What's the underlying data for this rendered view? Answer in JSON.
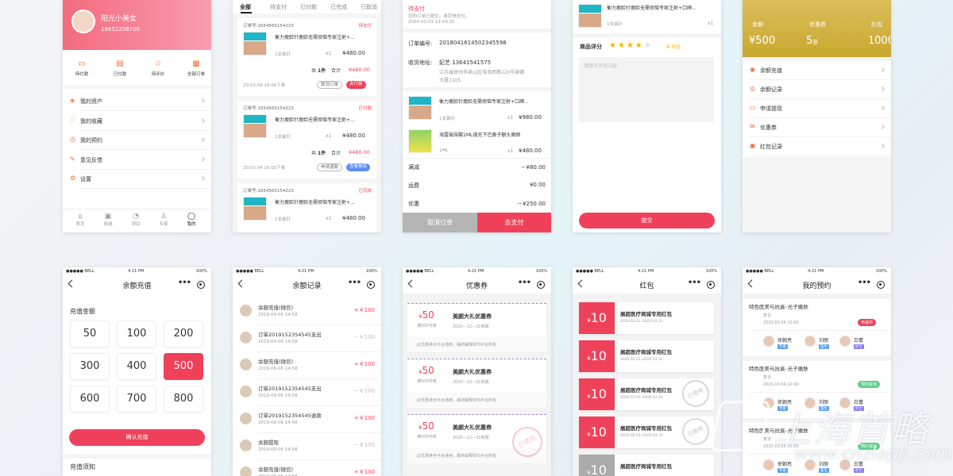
{
  "profile": {
    "name": "阳光小美女",
    "phone": "18652258700",
    "orders": [
      "待付款",
      "已付款",
      "待评价",
      "全部订单"
    ],
    "menu": [
      "我的资产",
      "我的收藏",
      "我的预约",
      "意见反馈",
      "设置"
    ],
    "tabs": [
      "首页",
      "商城",
      "项目",
      "专家",
      "我的"
    ]
  },
  "orders": {
    "tabs": [
      "全部",
      "待支付",
      "已付款",
      "已完成",
      "已取消"
    ],
    "items": [
      {
        "no": "订单号:1654565154223",
        "status": "待支付",
        "title": "衡力瘦脸针瘦脸无需烦恼专家注射+...",
        "spec": "1支装针",
        "qty": "x1",
        "price": "¥480.00",
        "total_a": "共",
        "total_b": "1件",
        "total_c": "合计",
        "total_v": "¥480.00",
        "time": "20:03.04 16:09下单",
        "btn1": "取消订单",
        "btn2": "去付款"
      },
      {
        "no": "订单号:1654565154223",
        "status": "已付款",
        "title": "衡力瘦脸针瘦脸无需烦恼专家注射+...",
        "spec": "1支装针",
        "qty": "x1",
        "price": "¥480.00",
        "total_a": "共",
        "total_b": "1件",
        "total_c": "合计",
        "total_v": "¥480.00",
        "time": "20:03.04 16:09下单",
        "btn1": "申请退款",
        "btn2": "查看物流"
      },
      {
        "no": "订单号:1654565154223",
        "status": "已完成",
        "title": "衡力瘦脸针瘦脸无需烦恼专家注射+...",
        "spec": "1支装针",
        "qty": "x1",
        "price": "¥480.00"
      }
    ]
  },
  "detail": {
    "status": "待支付",
    "note": "您的订单已提交，请尽快支付。",
    "time": "2020-03-01 13:54:25",
    "order_no_label": "订单编号:",
    "order_no": "2018041614502345598",
    "addr_label": "收货地址:",
    "person": "妃艺 13641541575",
    "addr1": "江苏省徐州市泉山区淮海西路120号颖都",
    "addr2": "大厦1105",
    "items": [
      {
        "title": "衡力瘦脸针瘦脸无需烦恼专家注射+口碑...",
        "spec": "1支装针",
        "qty": "x1",
        "price": "¥980.00"
      },
      {
        "title": "海露玻尿酸1ML填充下巴鼻子额头面颊",
        "spec": "1ML",
        "qty": "x1",
        "price": "¥480.00"
      }
    ],
    "fees": [
      {
        "k": "满减",
        "v": "－¥80.00"
      },
      {
        "k": "运费",
        "v": "¥0.00"
      },
      {
        "k": "优惠",
        "v": "－¥250.00"
      }
    ],
    "cancel": "取消订单",
    "pay": "去支付"
  },
  "review": {
    "title": "衡力瘦脸针瘦脸无需烦恼专家注射+口碑...",
    "spec": "1支装针",
    "qty": "x1",
    "score_label": "商品评分",
    "score": "4.0分",
    "rating": 4,
    "placeholder": "请填写评论内容",
    "submit": "提交"
  },
  "wallet": {
    "stats": [
      {
        "k": "余额",
        "v": "¥500"
      },
      {
        "k": "优惠券",
        "v": "5",
        "u": "张"
      },
      {
        "k": "红包",
        "v": "1000"
      }
    ],
    "menu": [
      "余额充值",
      "余额记录",
      "申请提现",
      "优惠券",
      "红包记录"
    ]
  },
  "status_bar": {
    "carrier": "●●●●● BELL",
    "time": "4:21 PM",
    "battery": "100%"
  },
  "recharge": {
    "title": "余额充值",
    "section": "充值金额",
    "amounts": [
      "50",
      "100",
      "200",
      "300",
      "400",
      "500",
      "600",
      "700",
      "800"
    ],
    "selected": "500",
    "confirm": "确认充值",
    "notice": "充值须知"
  },
  "records": {
    "title": "余额记录",
    "items": [
      {
        "t": "余额充值(微信)",
        "d": "2019-09-06 14:58",
        "v": "+￥100",
        "in": true
      },
      {
        "t": "订单2019152354545支出",
        "d": "2019-09-06 14:58",
        "v": "－￥100",
        "in": false
      },
      {
        "t": "余额充值(微信)",
        "d": "2019-09-06 14:58",
        "v": "+￥100",
        "in": true
      },
      {
        "t": "订单2019152354545支出",
        "d": "2019-09-06 14:58",
        "v": "－￥100",
        "in": false
      },
      {
        "t": "订单2019152354545退款",
        "d": "2019-09-06 14:58",
        "v": "+￥100",
        "in": true
      },
      {
        "t": "余额提现",
        "d": "2019-09-06 14:58",
        "v": "－￥100",
        "in": false
      },
      {
        "t": "余额充值(微信)",
        "d": "2019-09-06 14:58",
        "v": "+￥100",
        "in": true
      }
    ]
  },
  "coupons": {
    "title": "优惠券",
    "items": [
      {
        "amt": "50",
        "min": "满500可用",
        "name": "美颜大礼优惠券",
        "exp": "2020—12—31到期",
        "rule": "此优惠券全平台通用，最终解释权归平台所有"
      },
      {
        "amt": "50",
        "min": "满500可用",
        "name": "美颜大礼优惠券",
        "exp": "2020—12—31到期",
        "rule": "此优惠券全平台通用，最终解释权归平台所有"
      },
      {
        "amt": "50",
        "min": "满500可用",
        "name": "美颜大礼优惠券",
        "exp": "2020—12—31到期",
        "rule": "此优惠券全平台通用，最终解释权归平台所有",
        "used": "已使用"
      }
    ]
  },
  "redpacks": {
    "title": "红包",
    "items": [
      {
        "amt": "10",
        "name": "展超医疗商城专用红包",
        "date": "2020.02.01–2020.03.31"
      },
      {
        "amt": "10",
        "name": "展超医疗商城专用红包",
        "date": "2020.02.01–2020.03.31"
      },
      {
        "amt": "10",
        "name": "展超医疗商城专用红包",
        "date": "2020.02.01–2020.03.31",
        "used": "已使用"
      },
      {
        "amt": "10",
        "name": "展超医疗商城专用红包",
        "date": "2020.02.01–2020.03.31",
        "used": "已使用"
      },
      {
        "amt": "10",
        "name": "展超医疗商城专用红包",
        "date": "",
        "gray": true
      }
    ]
  },
  "appoint": {
    "title": "我的预约",
    "items": [
      {
        "name": "特色医美与抗衰–光子嫩肤",
        "t1": "复诊",
        "t2": "2020.03.04 10:00",
        "status": "申请中",
        "docs": [
          {
            "n": "徐朝亮",
            "r": "专家"
          },
          {
            "n": "刘丽",
            "r": "医生"
          },
          {
            "n": "白蕾",
            "r": "护士"
          }
        ]
      },
      {
        "name": "特色医美与抗衰–光子嫩肤",
        "t1": "复诊",
        "t2": "2020.03.04 10:00",
        "status": "预约成功",
        "docs": [
          {
            "n": "徐朝亮",
            "r": "专家"
          },
          {
            "n": "刘丽",
            "r": "医生"
          },
          {
            "n": "白蕾",
            "r": "护士"
          }
        ]
      },
      {
        "name": "特色医美与抗衰–光子嫩肤",
        "t1": "复诊",
        "t2": "2020.03.04 10:00",
        "status": "预约成功",
        "docs": [
          {
            "n": "徐朝亮",
            "r": "专家"
          },
          {
            "n": "刘丽",
            "r": "医生"
          },
          {
            "n": "白蕾",
            "r": "护士"
          }
        ]
      }
    ]
  },
  "watermark": {
    "text": "上海首略",
    "url": "www.cnzlapp.com"
  }
}
